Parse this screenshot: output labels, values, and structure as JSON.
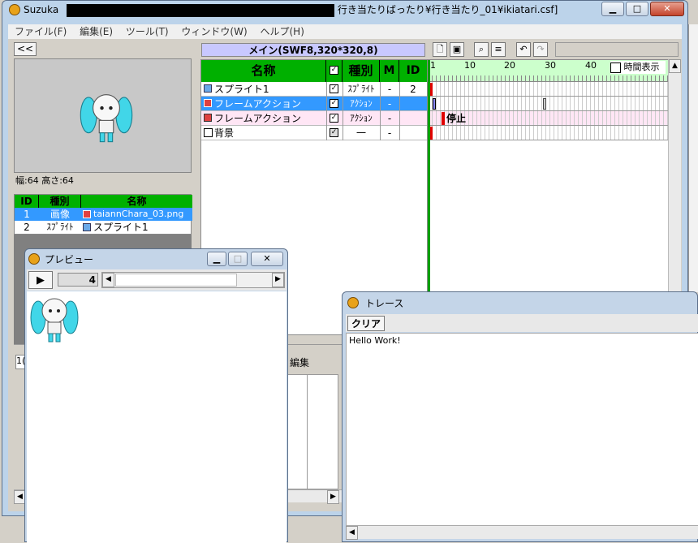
{
  "main_window": {
    "app_name": "Suzuka",
    "path_title": "行き当たりばったり¥行き当たり_01¥ikiatari.csf]",
    "menu": [
      "ファイル(F)",
      "編集(E)",
      "ツール(T)",
      "ウィンドウ(W)",
      "ヘルプ(H)"
    ],
    "collapse_button": "<<",
    "scene_label": "メイン(SWF8,320*320,8)",
    "size_label": "幅:64 高さ:64"
  },
  "library": {
    "headers": [
      "ID",
      "種別",
      "名称"
    ],
    "rows": [
      {
        "id": "1",
        "type": "画像",
        "name": "taiannChara_03.png"
      },
      {
        "id": "2",
        "type": "ｽﾌﾟﾗｲﾄ",
        "name": "スプライト1"
      }
    ]
  },
  "layers": {
    "headers": {
      "name": "名称",
      "type": "種別",
      "m": "M",
      "id": "ID"
    },
    "rows": [
      {
        "name": "スプライト1",
        "type": "ｽﾌﾟﾗｲﾄ",
        "m": "-",
        "id": "2"
      },
      {
        "name": "フレームアクション",
        "type": "ｱｸｼｮﾝ",
        "m": "-",
        "id": ""
      },
      {
        "name": "フレームアクション",
        "type": "ｱｸｼｮﾝ",
        "m": "-",
        "id": ""
      },
      {
        "name": "背景",
        "type": "一",
        "m": "-",
        "id": ""
      }
    ]
  },
  "timeline": {
    "ruler": [
      "1",
      "10",
      "20",
      "30",
      "40"
    ],
    "time_display_label": "時間表示",
    "stop_label": "停止"
  },
  "lower_panel": {
    "edit_label": "編集",
    "field_value": "1("
  },
  "preview_window": {
    "title": "プレビュー",
    "play_button": "▶",
    "frame_value": "4"
  },
  "trace_window": {
    "title": "トレース",
    "clear_button": "クリア",
    "output": "Hello Work!"
  },
  "colors": {
    "accent_green": "#00b000",
    "selection_blue": "#3399ff",
    "timeline_green": "#ccffcc"
  }
}
